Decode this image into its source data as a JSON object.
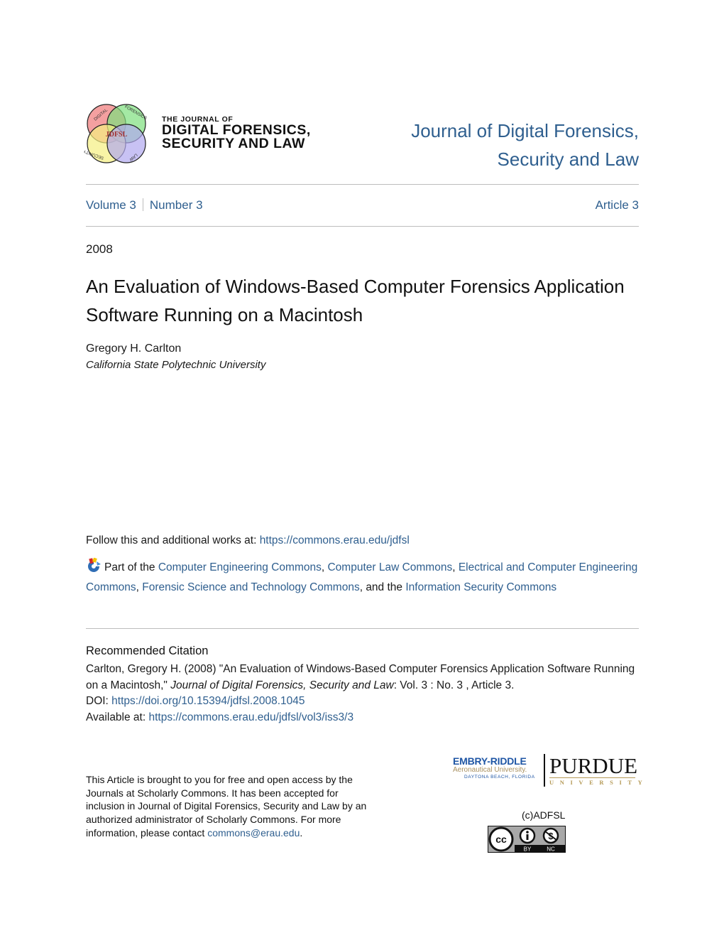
{
  "header": {
    "logo_alt": "The Journal of Digital Forensics, Security and Law",
    "logo_text_small": "THE JOURNAL OF",
    "logo_text_line1": "DIGITAL FORENSICS,",
    "logo_text_line2": "SECURITY AND LAW",
    "venn_labels": [
      "DIGITAL",
      "FORENSICS",
      "SECURITY",
      "LAW"
    ],
    "venn_center": "JDFSL",
    "journal_title_line1": "Journal of Digital Forensics,",
    "journal_title_line2": "Security and Law"
  },
  "issue": {
    "volume": "Volume 3",
    "number": "Number 3",
    "article": "Article 3"
  },
  "article": {
    "year": "2008",
    "title": "An Evaluation of Windows-Based Computer Forensics Application Software Running on a Macintosh",
    "author": "Gregory H. Carlton",
    "affiliation": "California State Polytechnic University"
  },
  "follow": {
    "label": "Follow this and additional works at: ",
    "url": "https://commons.erau.edu/jdfsl"
  },
  "part_of": {
    "prefix": "Part of the ",
    "links": [
      "Computer Engineering Commons",
      "Computer Law Commons",
      "Electrical and Computer Engineering Commons",
      "Forensic Science and Technology Commons",
      "Information Security Commons"
    ],
    "sep": ", ",
    "and_the": ", and the "
  },
  "citation": {
    "heading": "Recommended Citation",
    "text_part1": "Carlton, Gregory H. (2008) \"An Evaluation of Windows-Based Computer Forensics Application Software Running on a Macintosh,\" ",
    "journal_italic": "Journal of Digital Forensics, Security and Law",
    "text_part2": ": Vol. 3 : No. 3 , Article 3.",
    "doi_label": "DOI: ",
    "doi_url": "https://doi.org/10.15394/jdfsl.2008.1045",
    "available_label": "Available at: ",
    "available_url": "https://commons.erau.edu/jdfsl/vol3/iss3/3"
  },
  "footer": {
    "note": "This Article is brought to you for free and open access by the Journals at Scholarly Commons. It has been accepted for inclusion in Journal of Digital Forensics, Security and Law by an authorized administrator of Scholarly Commons. For more information, please contact ",
    "contact_email": "commons@erau.edu",
    "note_end": ".",
    "erau_line1": "EMBRY-RIDDLE",
    "erau_line2": "Aeronautical University.",
    "erau_line3": "DAYTONA BEACH, FLORIDA",
    "purdue_line1": "PURDUE",
    "purdue_line2": "UNIVERSITY",
    "copyright": "(c)ADFSL",
    "cc_labels": [
      "BY",
      "NC"
    ]
  },
  "colors": {
    "link": "#2f5f8f",
    "text": "#1a1a1a",
    "rule": "#bdbdbd"
  }
}
